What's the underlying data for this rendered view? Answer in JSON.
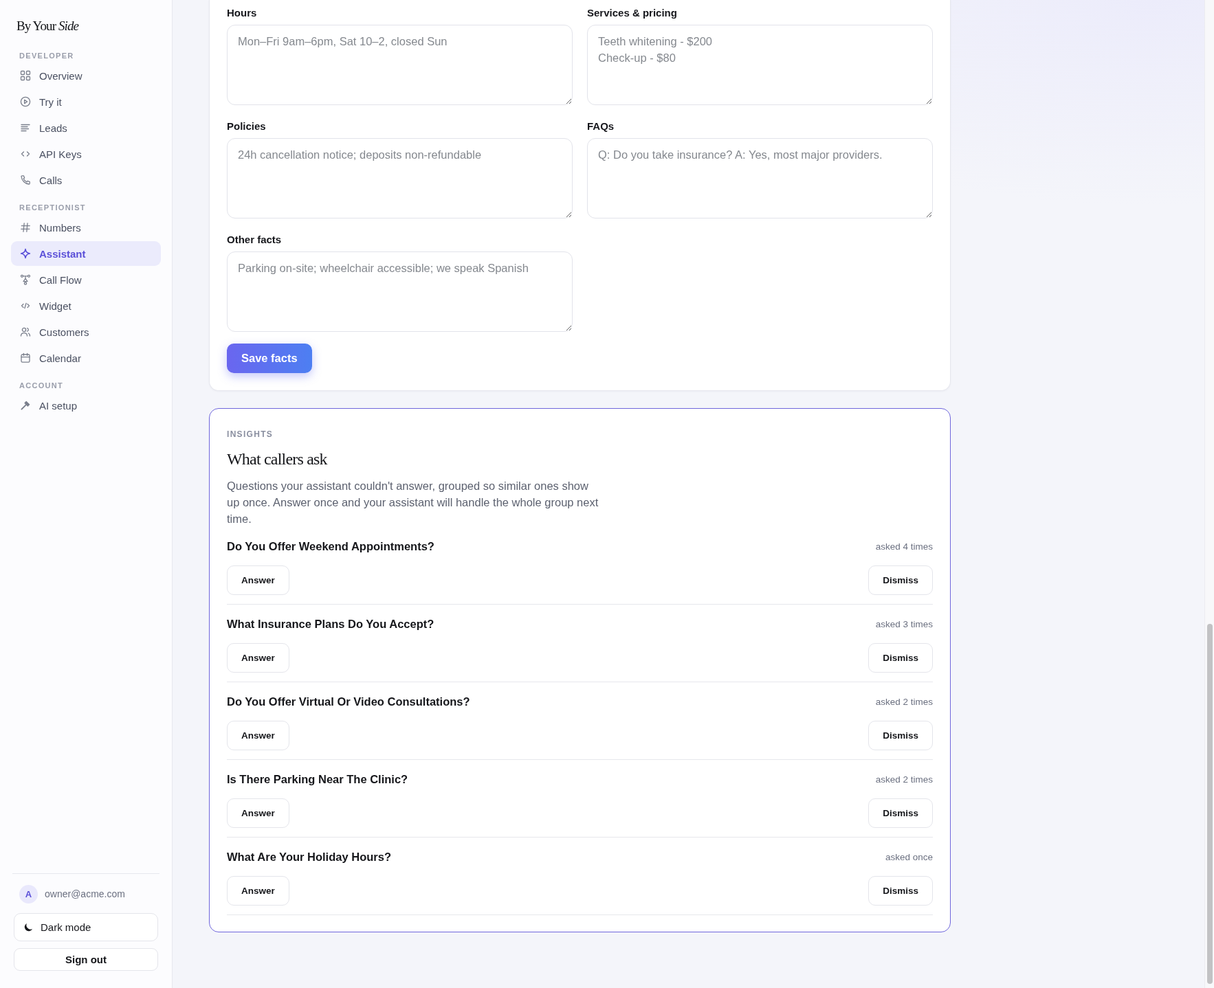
{
  "sidebar": {
    "logo": "By Your *Side*",
    "sections": [
      {
        "heading": "DEVELOPER",
        "items": [
          {
            "label": "Overview",
            "selected": false
          },
          {
            "label": "Try it",
            "selected": false
          },
          {
            "label": "Leads",
            "selected": false
          },
          {
            "label": "API Keys",
            "selected": false
          },
          {
            "label": "Calls",
            "selected": false
          }
        ]
      },
      {
        "heading": "RECEPTIONIST",
        "items": [
          {
            "label": "Numbers",
            "selected": false
          },
          {
            "label": "Assistant",
            "selected": true
          },
          {
            "label": "Call Flow",
            "selected": false
          },
          {
            "label": "Widget",
            "selected": false
          },
          {
            "label": "Customers",
            "selected": false
          },
          {
            "label": "Calendar",
            "selected": false
          }
        ]
      },
      {
        "heading": "ACCOUNT",
        "items": [
          {
            "label": "AI setup",
            "selected": false
          }
        ]
      }
    ],
    "user": {
      "avatar": "A",
      "email": "owner@acme.com"
    },
    "dark_mode_button": "Dark mode",
    "sign_out_button": "Sign out"
  },
  "facts_form": {
    "fields": [
      {
        "label": "Hours",
        "placeholder": "Mon–Fri 9am–6pm, Sat 10–2, closed Sun"
      },
      {
        "label": "Services & pricing",
        "placeholder": "Teeth whitening - $200\nCheck-up - $80"
      },
      {
        "label": "Policies",
        "placeholder": "24h cancellation notice; deposits non-refundable"
      },
      {
        "label": "FAQs",
        "placeholder": "Q: Do you take insurance? A: Yes, most major providers."
      },
      {
        "label": "Other facts",
        "placeholder": "Parking on-site; wheelchair accessible; we speak Spanish"
      }
    ],
    "save_button": "Save facts"
  },
  "insights": {
    "eyebrow": "INSIGHTS",
    "title": "What callers ask",
    "description": "Questions your assistant couldn't answer, grouped so similar ones show up once. Answer once and your assistant will handle the whole group next time.",
    "questions": [
      {
        "question": "Do You Offer Weekend Appointments?",
        "count": "asked 4 times",
        "answer_button": "Answer",
        "dismiss_button": "Dismiss"
      },
      {
        "question": "What Insurance Plans Do You Accept?",
        "count": "asked 3 times",
        "answer_button": "Answer",
        "dismiss_button": "Dismiss"
      },
      {
        "question": "Do You Offer Virtual Or Video Consultations?",
        "count": "asked 2 times",
        "answer_button": "Answer",
        "dismiss_button": "Dismiss"
      },
      {
        "question": "Is There Parking Near The Clinic?",
        "count": "asked 2 times",
        "answer_button": "Answer",
        "dismiss_button": "Dismiss"
      },
      {
        "question": "What Are Your Holiday Hours?",
        "count": "asked once",
        "answer_button": "Answer",
        "dismiss_button": "Dismiss"
      }
    ]
  }
}
